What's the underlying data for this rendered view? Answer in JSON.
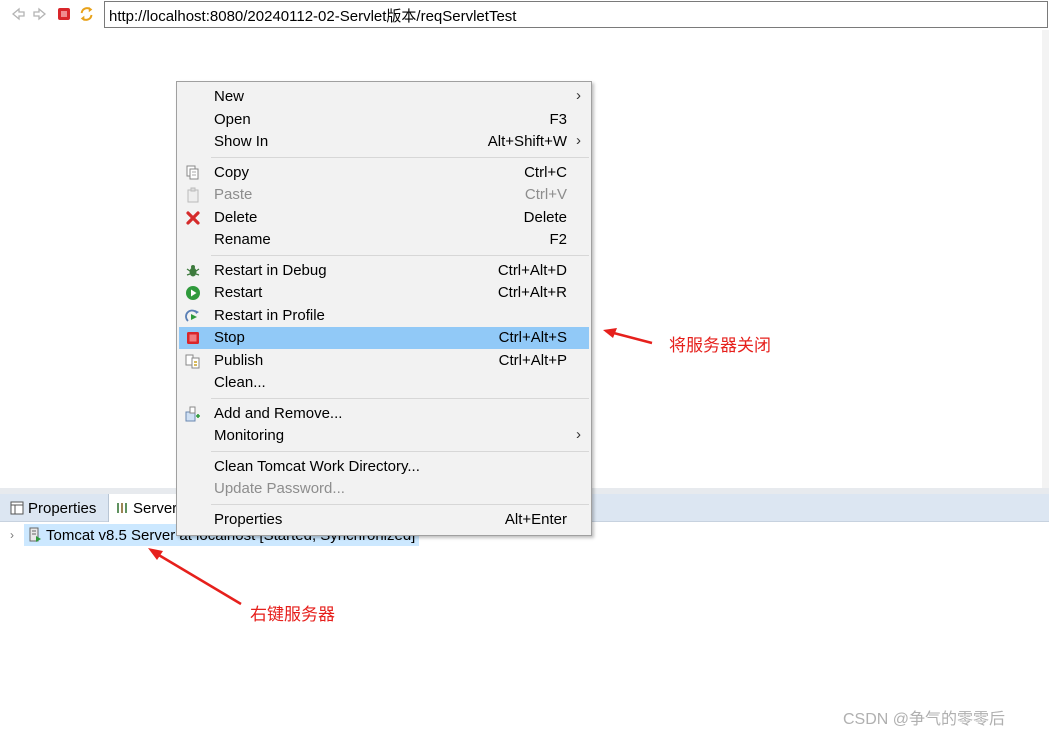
{
  "browser": {
    "url": "http://localhost:8080/20240112-02-Servlet版本/reqServletTest",
    "icons": [
      "back-arrow-icon",
      "forward-arrow-icon",
      "stop-icon",
      "refresh-icon"
    ]
  },
  "context_menu": {
    "groups": [
      [
        {
          "label": "New",
          "shortcut": "",
          "submenu": true,
          "icon": ""
        },
        {
          "label": "Open",
          "shortcut": "F3",
          "submenu": false,
          "icon": ""
        },
        {
          "label": "Show In",
          "shortcut": "Alt+Shift+W",
          "submenu": true,
          "icon": ""
        }
      ],
      [
        {
          "label": "Copy",
          "shortcut": "Ctrl+C",
          "icon": "copy-icon"
        },
        {
          "label": "Paste",
          "shortcut": "Ctrl+V",
          "icon": "paste-icon",
          "disabled": true
        },
        {
          "label": "Delete",
          "shortcut": "Delete",
          "icon": "delete-icon"
        },
        {
          "label": "Rename",
          "shortcut": "F2",
          "icon": ""
        }
      ],
      [
        {
          "label": "Restart in Debug",
          "shortcut": "Ctrl+Alt+D",
          "icon": "debug-bug-icon"
        },
        {
          "label": "Restart",
          "shortcut": "Ctrl+Alt+R",
          "icon": "run-icon"
        },
        {
          "label": "Restart in Profile",
          "shortcut": "",
          "icon": "profile-icon"
        },
        {
          "label": "Stop",
          "shortcut": "Ctrl+Alt+S",
          "icon": "stop-icon",
          "selected": true
        },
        {
          "label": "Publish",
          "shortcut": "Ctrl+Alt+P",
          "icon": "publish-icon"
        },
        {
          "label": "Clean...",
          "shortcut": "",
          "icon": ""
        }
      ],
      [
        {
          "label": "Add and Remove...",
          "shortcut": "",
          "icon": "add-remove-icon"
        },
        {
          "label": "Monitoring",
          "shortcut": "",
          "submenu": true,
          "icon": ""
        }
      ],
      [
        {
          "label": "Clean Tomcat Work Directory...",
          "shortcut": "",
          "icon": ""
        },
        {
          "label": "Update Password...",
          "shortcut": "",
          "icon": "",
          "disabled": true
        }
      ],
      [
        {
          "label": "Properties",
          "shortcut": "Alt+Enter",
          "icon": ""
        }
      ]
    ]
  },
  "bottom_panel": {
    "tabs": [
      {
        "label": "Properties",
        "icon": "properties-icon"
      },
      {
        "label": "Servers",
        "icon": "servers-icon"
      }
    ],
    "server_item": "Tomcat v8.5 Server at localhost  [Started, Synchronized]"
  },
  "annotations": {
    "stop_note": "将服务器关闭",
    "rightclick_note": "右键服务器",
    "color": "#e6201c"
  },
  "watermark": "CSDN @争气的零零后",
  "colors": {
    "selection": "#91c9f7",
    "menu_bg": "#f2f2f2",
    "tabbar_bg": "#dce6f2",
    "tree_selection": "#cce8ff"
  }
}
